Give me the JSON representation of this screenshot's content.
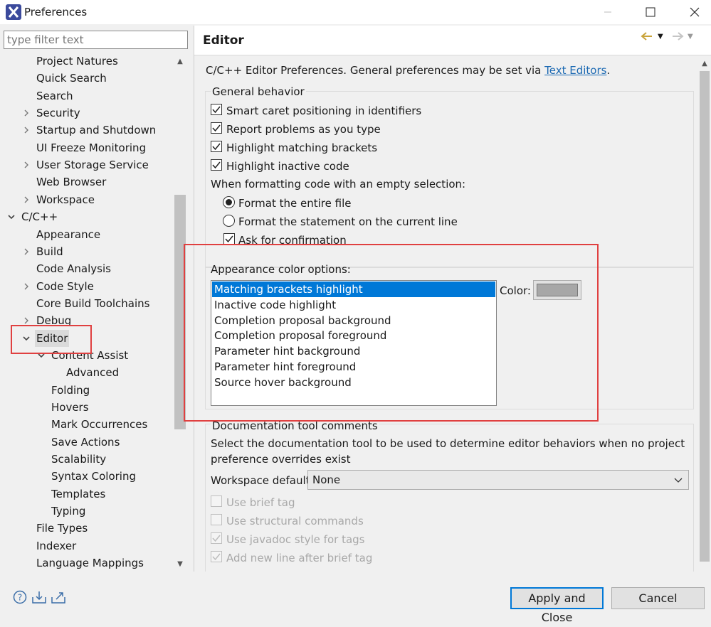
{
  "window": {
    "title": "Preferences"
  },
  "filter": {
    "placeholder": "type filter text"
  },
  "tree": [
    {
      "label": "Project Natures",
      "indent": 1,
      "exp": ""
    },
    {
      "label": "Quick Search",
      "indent": 1,
      "exp": ""
    },
    {
      "label": "Search",
      "indent": 1,
      "exp": ""
    },
    {
      "label": "Security",
      "indent": 1,
      "exp": "collapsed"
    },
    {
      "label": "Startup and Shutdown",
      "indent": 1,
      "exp": "collapsed"
    },
    {
      "label": "UI Freeze Monitoring",
      "indent": 1,
      "exp": ""
    },
    {
      "label": "User Storage Service",
      "indent": 1,
      "exp": "collapsed"
    },
    {
      "label": "Web Browser",
      "indent": 1,
      "exp": ""
    },
    {
      "label": "Workspace",
      "indent": 1,
      "exp": "collapsed"
    },
    {
      "label": "C/C++",
      "indent": 0,
      "exp": "expanded"
    },
    {
      "label": "Appearance",
      "indent": 1,
      "exp": ""
    },
    {
      "label": "Build",
      "indent": 1,
      "exp": "collapsed"
    },
    {
      "label": "Code Analysis",
      "indent": 1,
      "exp": ""
    },
    {
      "label": "Code Style",
      "indent": 1,
      "exp": "collapsed"
    },
    {
      "label": "Core Build Toolchains",
      "indent": 1,
      "exp": ""
    },
    {
      "label": "Debug",
      "indent": 1,
      "exp": "collapsed"
    },
    {
      "label": "Editor",
      "indent": 1,
      "exp": "expanded",
      "selected": true
    },
    {
      "label": "Content Assist",
      "indent": 2,
      "exp": "expanded"
    },
    {
      "label": "Advanced",
      "indent": 3,
      "exp": ""
    },
    {
      "label": "Folding",
      "indent": 2,
      "exp": ""
    },
    {
      "label": "Hovers",
      "indent": 2,
      "exp": ""
    },
    {
      "label": "Mark Occurrences",
      "indent": 2,
      "exp": ""
    },
    {
      "label": "Save Actions",
      "indent": 2,
      "exp": ""
    },
    {
      "label": "Scalability",
      "indent": 2,
      "exp": ""
    },
    {
      "label": "Syntax Coloring",
      "indent": 2,
      "exp": ""
    },
    {
      "label": "Templates",
      "indent": 2,
      "exp": ""
    },
    {
      "label": "Typing",
      "indent": 2,
      "exp": ""
    },
    {
      "label": "File Types",
      "indent": 1,
      "exp": ""
    },
    {
      "label": "Indexer",
      "indent": 1,
      "exp": ""
    },
    {
      "label": "Language Mappings",
      "indent": 1,
      "exp": ""
    }
  ],
  "page": {
    "title": "Editor",
    "intro": "C/C++ Editor Preferences. General preferences may be set via",
    "intro_link": "Text Editors",
    "intro_end": ".",
    "general_group": "General behavior",
    "checks": [
      {
        "label": "Smart caret positioning in identifiers",
        "checked": true
      },
      {
        "label": "Report problems as you type",
        "checked": true
      },
      {
        "label": "Highlight matching brackets",
        "checked": true
      },
      {
        "label": "Highlight inactive code",
        "checked": true
      }
    ],
    "format_label": "When formatting code with an empty selection:",
    "radios": [
      {
        "label": "Format the entire file",
        "checked": true
      },
      {
        "label": "Format the statement on the current line",
        "checked": false
      }
    ],
    "ask_confirm": {
      "label": "Ask for confirmation",
      "checked": true
    },
    "appearance_label": "Appearance color options:",
    "color_items": [
      "Matching brackets highlight",
      "Inactive code highlight",
      "Completion proposal background",
      "Completion proposal foreground",
      "Parameter hint background",
      "Parameter hint foreground",
      "Source hover background"
    ],
    "color_label": "Color:",
    "swatch_color": "#a7a7a7",
    "doc_group": "Documentation tool comments",
    "doc_desc_1": "Select the documentation tool to be used to determine editor behaviors when no project",
    "doc_desc_2": "preference overrides exist",
    "workspace_default_label": "Workspace default:",
    "workspace_default_value": "None",
    "disabled_checks": [
      {
        "label": "Use brief tag",
        "checked": false
      },
      {
        "label": "Use structural commands",
        "checked": false
      },
      {
        "label": "Use javadoc style for tags",
        "checked": true
      },
      {
        "label": "Add new line after brief tag",
        "checked": true
      }
    ]
  },
  "buttons": {
    "apply_close": "Apply and Close",
    "cancel": "Cancel"
  },
  "colors": {
    "accent": "#0078d7",
    "highlight_box": "#e04040",
    "link": "#1d6ab3"
  }
}
